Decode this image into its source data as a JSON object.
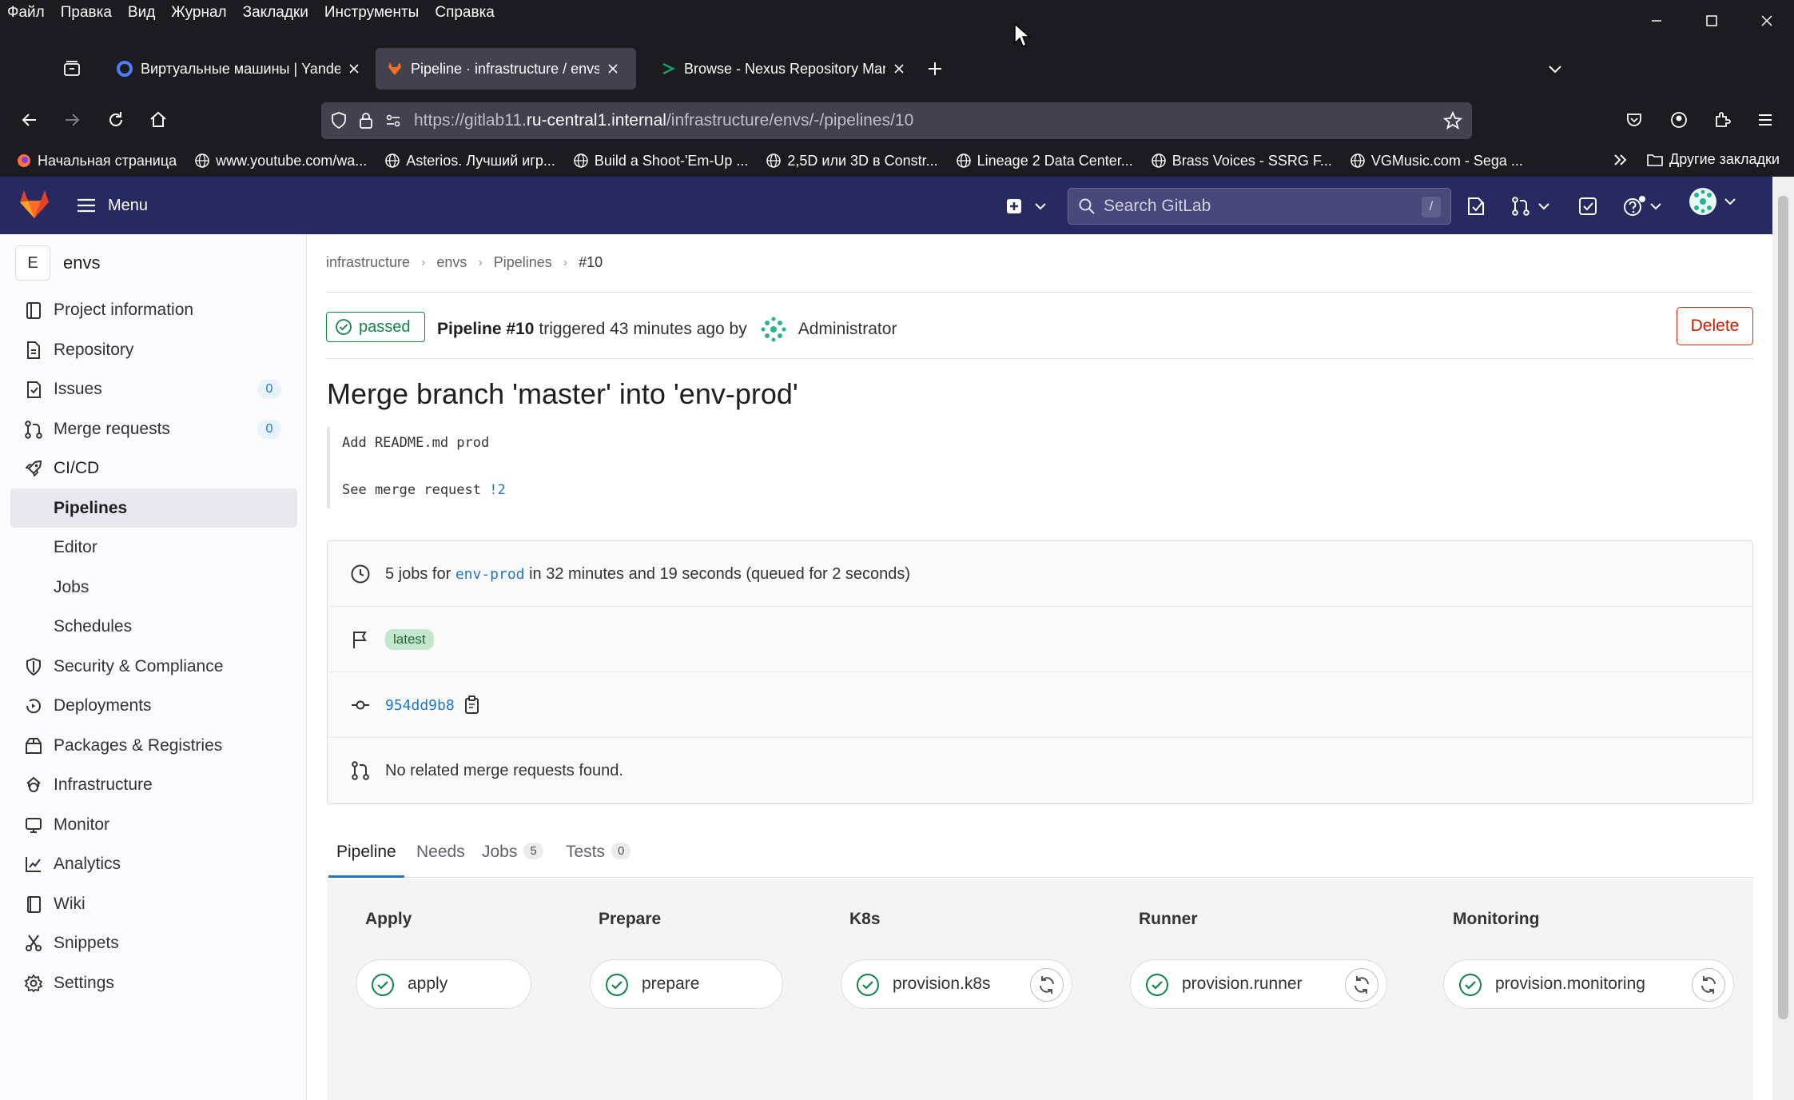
{
  "browser": {
    "menu": [
      "Файл",
      "Правка",
      "Вид",
      "Журнал",
      "Закладки",
      "Инструменты",
      "Справка"
    ],
    "tabs": [
      {
        "title": "Виртуальные машины | Yandex"
      },
      {
        "title": "Pipeline · infrastructure / envs · GitLab"
      },
      {
        "title": "Browse - Nexus Repository Manager"
      }
    ],
    "url_prefix": "https://gitlab11.",
    "url_domain": "ru-central1.internal",
    "url_path": "/infrastructure/envs/-/pipelines/10",
    "bookmarks": [
      "Начальная страница",
      "www.youtube.com/wa...",
      "Asterios. Лучший игр...",
      "Build a Shoot-'Em-Up ...",
      "2,5D или 3D в Constr...",
      "Lineage 2 Data Center...",
      "Brass Voices - SSRG F...",
      "VGMusic.com - Sega ..."
    ],
    "other_bookmarks": "Другие закладки"
  },
  "gitlab": {
    "menu_label": "Menu",
    "search_placeholder": "Search GitLab",
    "search_shortcut": "/"
  },
  "sidebar": {
    "project_initial": "E",
    "project_name": "envs",
    "items": [
      {
        "label": "Project information",
        "icon": "info-icon"
      },
      {
        "label": "Repository",
        "icon": "doc-icon"
      },
      {
        "label": "Issues",
        "icon": "issues-icon",
        "badge": "0"
      },
      {
        "label": "Merge requests",
        "icon": "merge-request-icon",
        "badge": "0"
      },
      {
        "label": "CI/CD",
        "icon": "rocket-icon"
      },
      {
        "label": "Pipelines",
        "sub": true,
        "active": true
      },
      {
        "label": "Editor",
        "sub": true
      },
      {
        "label": "Jobs",
        "sub": true
      },
      {
        "label": "Schedules",
        "sub": true
      },
      {
        "label": "Security & Compliance",
        "icon": "shield-icon"
      },
      {
        "label": "Deployments",
        "icon": "deployments-icon"
      },
      {
        "label": "Packages & Registries",
        "icon": "package-icon"
      },
      {
        "label": "Infrastructure",
        "icon": "cloud-icon"
      },
      {
        "label": "Monitor",
        "icon": "monitor-icon"
      },
      {
        "label": "Analytics",
        "icon": "chart-icon"
      },
      {
        "label": "Wiki",
        "icon": "book-icon"
      },
      {
        "label": "Snippets",
        "icon": "scissors-icon"
      },
      {
        "label": "Settings",
        "icon": "gear-icon"
      }
    ]
  },
  "breadcrumbs": [
    "infrastructure",
    "envs",
    "Pipelines",
    "#10"
  ],
  "pipeline": {
    "status": "passed",
    "title": "Pipeline #10",
    "triggered": "triggered 43 minutes ago by",
    "user": "Administrator",
    "delete_label": "Delete",
    "commit_title": "Merge branch 'master' into 'env-prod'",
    "commit_line1": "Add README.md prod",
    "commit_line2": "See merge request ",
    "commit_mr": "!2",
    "jobs_prefix": "5 jobs for ",
    "jobs_ref": "env-prod",
    "jobs_suffix": " in 32 minutes and 19 seconds (queued for 2 seconds)",
    "tag": "latest",
    "sha": "954dd9b8",
    "no_mr": "No related merge requests found."
  },
  "tabs": [
    {
      "label": "Pipeline",
      "active": true
    },
    {
      "label": "Needs"
    },
    {
      "label": "Jobs",
      "count": "5"
    },
    {
      "label": "Tests",
      "count": "0"
    }
  ],
  "stages": [
    {
      "title": "Apply",
      "job": "apply",
      "retry": false
    },
    {
      "title": "Prepare",
      "job": "prepare",
      "retry": false
    },
    {
      "title": "K8s",
      "job": "provision.k8s",
      "retry": true
    },
    {
      "title": "Runner",
      "job": "provision.runner",
      "retry": true
    },
    {
      "title": "Monitoring",
      "job": "provision.monitoring",
      "retry": true
    }
  ],
  "colors": {
    "gitlab_nav": "#292961",
    "success": "#108548",
    "danger": "#dd2b0e",
    "link": "#1f75cb"
  }
}
